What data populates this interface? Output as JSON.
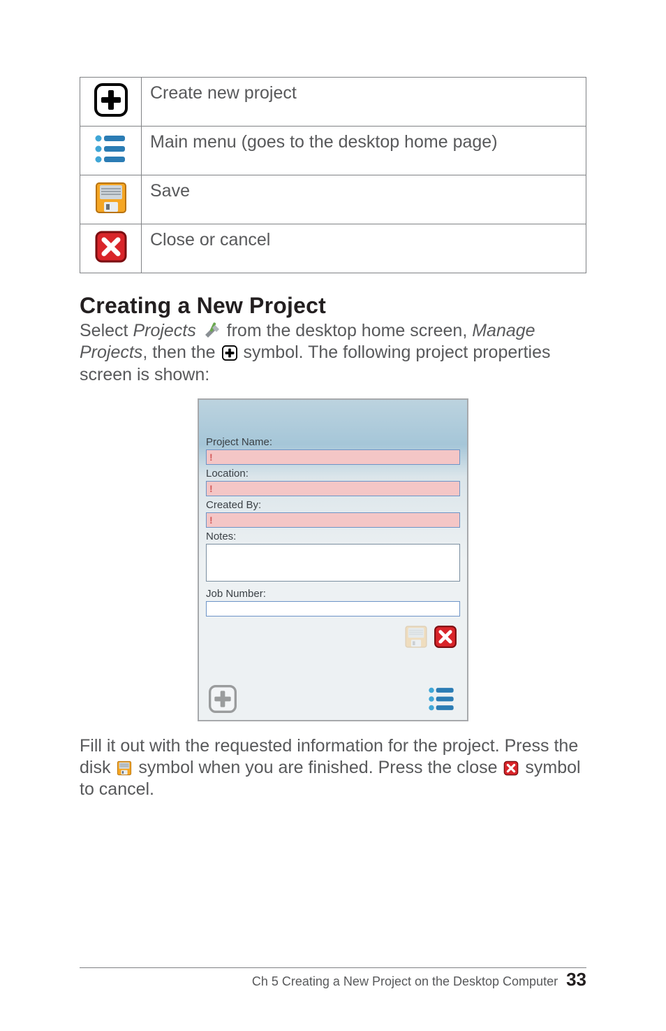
{
  "icon_table": {
    "rows": [
      {
        "icon": "plus",
        "desc": "Create new project"
      },
      {
        "icon": "menu",
        "desc": "Main menu (goes to the desktop home page)"
      },
      {
        "icon": "save",
        "desc": "Save"
      },
      {
        "icon": "close",
        "desc": "Close or cancel"
      }
    ]
  },
  "heading": "Creating a New Project",
  "para1": {
    "pre": "Select ",
    "projects": "Projects",
    "mid1": " from the desktop home screen, ",
    "manage": "Manage Projects",
    "mid2": ", then the ",
    "post": " symbol. The following project properties screen is shown:"
  },
  "dialog": {
    "project_name_label": "Project Name:",
    "project_name_value": "!",
    "location_label": "Location:",
    "location_value": "!",
    "created_by_label": "Created By:",
    "created_by_value": "!",
    "notes_label": "Notes:",
    "notes_value": "",
    "job_number_label": "Job Number:",
    "job_number_value": ""
  },
  "para2": {
    "t1": "Fill it out with the requested information for the project. Press the disk ",
    "t2": " symbol when you are finished. Press the close ",
    "t3": " symbol to cancel."
  },
  "footer": {
    "chapter": "Ch 5   Creating a New Project on the Desktop Computer",
    "page": "33"
  },
  "colors": {
    "plus_border": "#010101",
    "menu_blue1": "#3fa6d6",
    "menu_blue2": "#2b7cb4",
    "save_orange": "#f5a623",
    "save_gray": "#9aa3aa",
    "close_red": "#d9252a",
    "close_border": "#7c0e11"
  }
}
